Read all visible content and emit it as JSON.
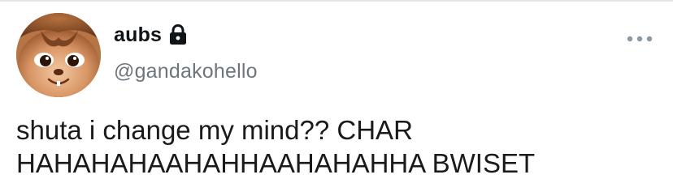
{
  "tweet": {
    "display_name": "aubs",
    "handle": "@gandakohello",
    "text": "shuta i change my mind?? CHAR\nHAHAHAHAAHAHHAAHAHAHHA BWISET",
    "avatar_icon": "avatar-chipmunk",
    "lock_icon": "lock-icon",
    "more_icon": "more-options-icon"
  },
  "colors": {
    "handle": "#6e767d",
    "text": "#0f1419",
    "divider": "#e6e6e6"
  }
}
